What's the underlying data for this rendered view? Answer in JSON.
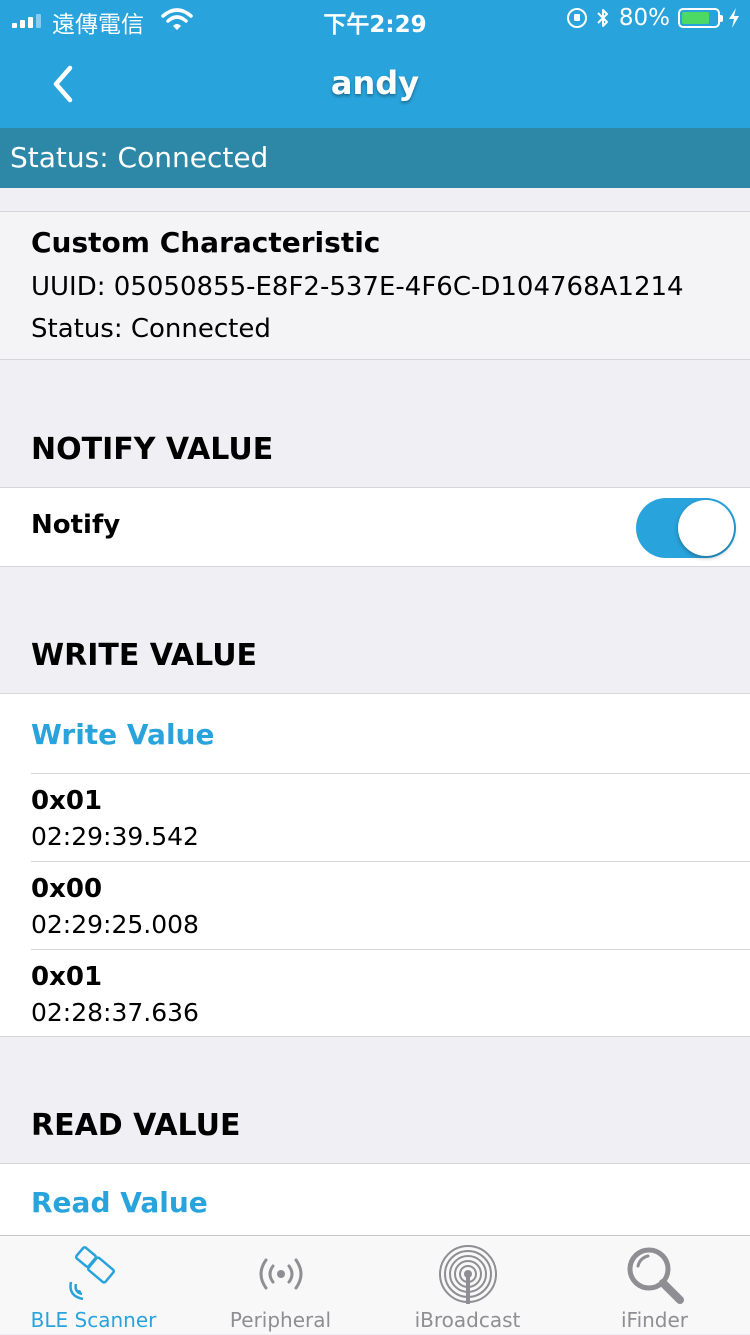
{
  "status_bar": {
    "carrier": "遠傳電信",
    "time": "下午2:29",
    "battery_percent": "80%",
    "battery_level": 0.8,
    "battery_color": "#4cd964"
  },
  "nav": {
    "title": "andy",
    "back_icon": "chevron-left-icon",
    "bar_color": "#29a3dc"
  },
  "connection_status": "Status: Connected",
  "characteristic": {
    "title": "Custom Characteristic",
    "uuid": "UUID: 05050855-E8F2-537E-4F6C-D104768A1214",
    "status": "Status: Connected"
  },
  "notify_section": {
    "header": "NOTIFY VALUE",
    "label": "Notify",
    "enabled": true
  },
  "write_section": {
    "header": "WRITE VALUE",
    "button": "Write Value",
    "entries": [
      {
        "value": "0x01",
        "time": "02:29:39.542"
      },
      {
        "value": "0x00",
        "time": "02:29:25.008"
      },
      {
        "value": "0x01",
        "time": "02:28:37.636"
      }
    ]
  },
  "read_section": {
    "header": "READ VALUE",
    "button": "Read Value"
  },
  "tabs": [
    {
      "label": "BLE Scanner",
      "icon": "ble-scanner-icon",
      "active": true
    },
    {
      "label": "Peripheral",
      "icon": "peripheral-icon",
      "active": false
    },
    {
      "label": "iBroadcast",
      "icon": "ibroadcast-icon",
      "active": false
    },
    {
      "label": "iFinder",
      "icon": "ifinder-icon",
      "active": false
    }
  ],
  "accent_color": "#29a3dc"
}
